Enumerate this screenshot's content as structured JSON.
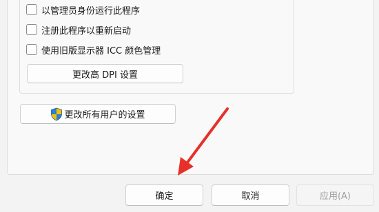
{
  "options": {
    "run_as_admin": {
      "label": "以管理员身份运行此程序",
      "checked": false
    },
    "register_restart": {
      "label": "注册此程序以重新启动",
      "checked": false
    },
    "legacy_icc": {
      "label": "使用旧版显示器 ICC 颜色管理",
      "checked": false
    }
  },
  "change_dpi_label": "更改高 DPI 设置",
  "change_all_users_label": "更改所有用户的设置",
  "dialog_buttons": {
    "ok": "确定",
    "cancel": "取消",
    "apply": "应用(A)"
  },
  "colors": {
    "annotation_arrow": "#e8302a",
    "shield_blue": "#2f7fd0",
    "shield_yellow": "#f2c200"
  },
  "icons": {
    "uac_shield": "uac-shield-icon",
    "annotation": "red-arrow"
  }
}
